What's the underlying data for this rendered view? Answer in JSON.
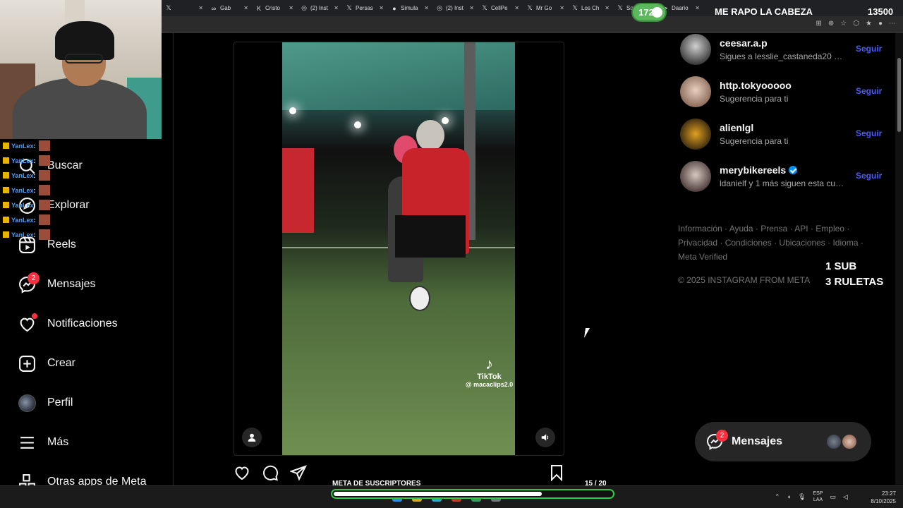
{
  "browser": {
    "tabs": [
      {
        "icon": "x-icon",
        "glyph": "𝕏",
        "title": ""
      },
      {
        "icon": "link-icon",
        "glyph": "∞",
        "title": "Gab"
      },
      {
        "icon": "kick-icon",
        "glyph": "K",
        "title": "Cristo"
      },
      {
        "icon": "instagram-icon",
        "glyph": "◎",
        "title": "(2) Inst"
      },
      {
        "icon": "x-icon",
        "glyph": "𝕏",
        "title": "Persas"
      },
      {
        "icon": "github-icon",
        "glyph": "●",
        "title": "Simula"
      },
      {
        "icon": "instagram-icon",
        "glyph": "◎",
        "title": "(2) Inst"
      },
      {
        "icon": "x-icon",
        "glyph": "𝕏",
        "title": "CellPe"
      },
      {
        "icon": "x-icon",
        "glyph": "𝕏",
        "title": "Mr Go"
      },
      {
        "icon": "x-icon",
        "glyph": "𝕏",
        "title": "Los Ch"
      },
      {
        "icon": "x-icon",
        "glyph": "𝕏",
        "title": "SoyPa"
      },
      {
        "icon": "youtube-icon",
        "glyph": "▶",
        "title": "Daario"
      }
    ]
  },
  "stream": {
    "counter": "1723",
    "headline": "ME RAPO LA CABEZA",
    "number": "13500",
    "sub_line1": "1 SUB",
    "sub_line2": "3 RULETAS",
    "goal_title": "META DE SUSCRIPTORES",
    "goal_count": "15  / 20",
    "goal_progress": 0.75
  },
  "chat": [
    {
      "user": "YanLex",
      "sep": ":"
    },
    {
      "user": "YanLex",
      "sep": ":"
    },
    {
      "user": "YanLex",
      "sep": ":"
    },
    {
      "user": "YanLex",
      "sep": ":"
    },
    {
      "user": "YanLex",
      "sep": ":"
    },
    {
      "user": "YanLex",
      "sep": ":"
    },
    {
      "user": "YanLex",
      "sep": ":"
    }
  ],
  "nav": {
    "search": "Buscar",
    "explore": "Explorar",
    "reels": "Reels",
    "messages": "Mensajes",
    "messages_badge": "2",
    "notifications": "Notificaciones",
    "create": "Crear",
    "profile": "Perfil",
    "more": "Más",
    "meta_apps": "Otras apps de Meta"
  },
  "post": {
    "tiktok_label": "TikTok",
    "tiktok_user": "@ macaclips2.0"
  },
  "suggestions": [
    {
      "name": "ceesar.a.p",
      "subtitle": "Sigues a lesslie_castaneda20 y 1...",
      "action": "Seguir",
      "verified": false
    },
    {
      "name": "http.tokyooooo",
      "subtitle": "Sugerencia para ti",
      "action": "Seguir",
      "verified": false
    },
    {
      "name": "alienlgl",
      "subtitle": "Sugerencia para ti",
      "action": "Seguir",
      "verified": false
    },
    {
      "name": "merybikereels",
      "subtitle": "ldanielf y 1 más siguen esta cue...",
      "action": "Seguir",
      "verified": true
    }
  ],
  "footer": {
    "links": [
      "Información",
      "Ayuda",
      "Prensa",
      "API",
      "Empleo",
      "Privacidad",
      "Condiciones",
      "Ubicaciones",
      "Idioma",
      "Meta Verified"
    ],
    "separator": " · ",
    "copyright": "© 2025 INSTAGRAM FROM META"
  },
  "messages_pill": {
    "label": "Mensajes",
    "badge": "2"
  },
  "taskbar": {
    "lang_top": "ESP",
    "lang_bottom": "LAA",
    "time": "23:27",
    "date": "8/10/2025"
  },
  "colors": {
    "accent_blue": "#4a5df9",
    "badge_red": "#ff3040",
    "goal_green": "#2ecc40",
    "counter_green": "#5cb85c"
  }
}
